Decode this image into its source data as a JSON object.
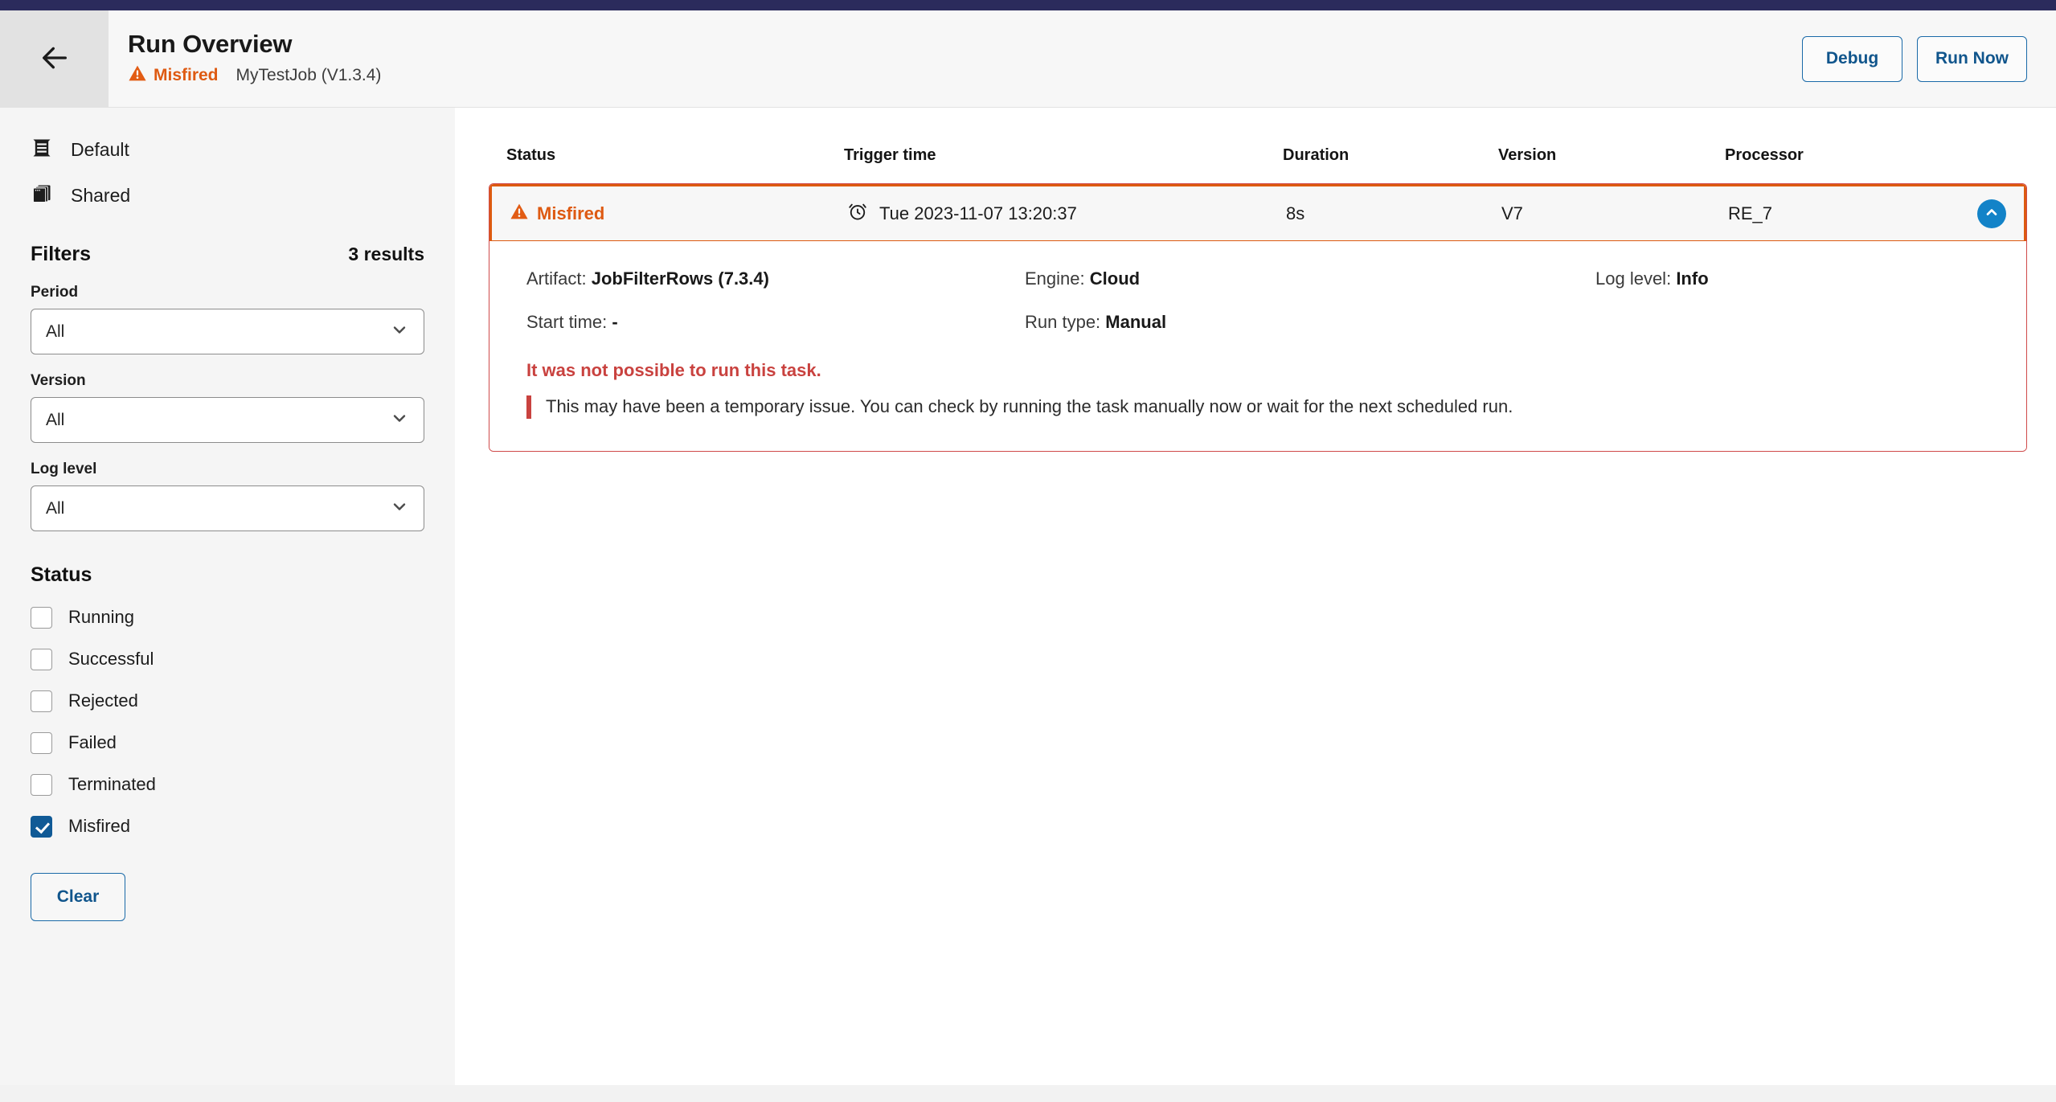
{
  "header": {
    "back_icon": "back-arrow-icon",
    "title": "Run Overview",
    "status": "Misfired",
    "status_icon": "warning-triangle-icon",
    "status_color": "#de5a12",
    "job_name": "MyTestJob (V1.3.4)",
    "debug_label": "Debug",
    "run_now_label": "Run Now"
  },
  "sidebar": {
    "nav": [
      {
        "label": "Default",
        "icon": "list-view-icon"
      },
      {
        "label": "Shared",
        "icon": "stacked-cards-icon"
      }
    ],
    "filters_title": "Filters",
    "results_count": "3 results",
    "fields": [
      {
        "label": "Period",
        "value": "All",
        "icon": "chevron-down-icon"
      },
      {
        "label": "Version",
        "value": "All",
        "icon": "chevron-down-icon"
      },
      {
        "label": "Log level",
        "value": "All",
        "icon": "chevron-down-icon"
      }
    ],
    "status_title": "Status",
    "status_options": [
      {
        "label": "Running",
        "checked": false
      },
      {
        "label": "Successful",
        "checked": false
      },
      {
        "label": "Rejected",
        "checked": false
      },
      {
        "label": "Failed",
        "checked": false
      },
      {
        "label": "Terminated",
        "checked": false
      },
      {
        "label": "Misfired",
        "checked": true
      }
    ],
    "clear_label": "Clear"
  },
  "table": {
    "columns": [
      "Status",
      "Trigger time",
      "Duration",
      "Version",
      "Processor"
    ],
    "row": {
      "status": "Misfired",
      "status_icon": "warning-triangle-icon",
      "trigger_time": "Tue 2023-11-07 13:20:37",
      "trigger_icon": "alarm-clock-icon",
      "duration": "8s",
      "version": "V7",
      "processor": "RE_7",
      "collapse_icon": "chevron-up-icon"
    },
    "detail": {
      "artifact_label": "Artifact:",
      "artifact_value": "JobFilterRows (7.3.4)",
      "engine_label": "Engine:",
      "engine_value": "Cloud",
      "loglevel_label": "Log level:",
      "loglevel_value": "Info",
      "starttime_label": "Start time:",
      "starttime_value": "-",
      "runtype_label": "Run type:",
      "runtype_value": "Manual",
      "error_title": "It was not possible to run this task.",
      "error_body": "This may have been a temporary issue. You can check by running the task manually now or wait for the next scheduled run."
    }
  },
  "colors": {
    "navy": "#2b2b5c",
    "orange": "#dd5a10",
    "blue": "#10558c",
    "red": "#c9423f"
  }
}
